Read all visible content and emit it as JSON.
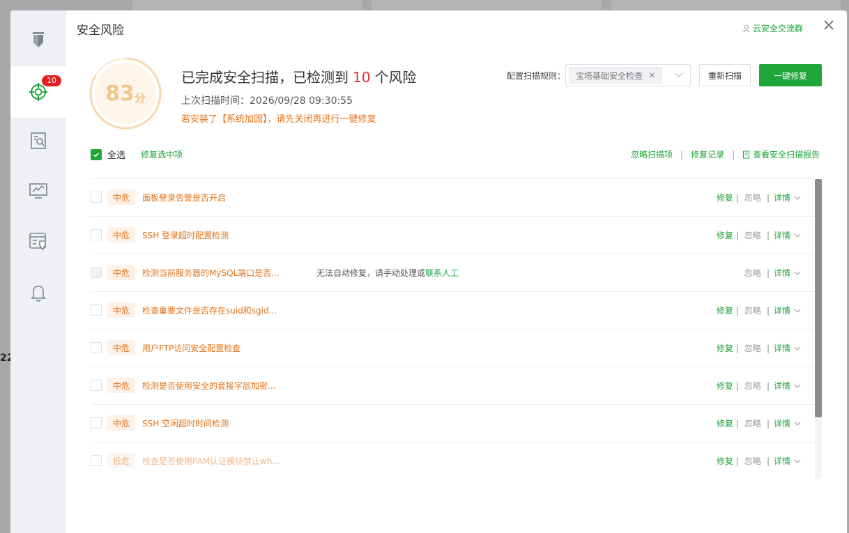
{
  "dialog": {
    "title": "安全风险",
    "group_link": "云安全交流群",
    "close_icon": "close-icon"
  },
  "sidebar": {
    "items": [
      {
        "icon": "tower-logo-icon",
        "active": false
      },
      {
        "icon": "target-scan-icon",
        "active": true,
        "badge": "10"
      },
      {
        "icon": "file-search-icon",
        "active": false
      },
      {
        "icon": "monitor-chart-icon",
        "active": false
      },
      {
        "icon": "list-shield-icon",
        "active": false
      },
      {
        "icon": "bell-icon",
        "active": false
      }
    ]
  },
  "score": {
    "value": "83",
    "unit": "分",
    "ring_fraction": 0.83
  },
  "summary": {
    "headline_prefix": "已完成安全扫描，已检测到",
    "risk_count": "10",
    "headline_suffix": "个风险",
    "last_scan": "上次扫描时间：2026/09/28 09:30:55",
    "warning": "若安装了【系统加固】，请先关闭再进行一键修复"
  },
  "scan_rule": {
    "label": "配置扫描规则：",
    "selected": "宝塔基础安全检查"
  },
  "buttons": {
    "rescan": "重新扫描",
    "fix_all": "一键修复"
  },
  "toolbar": {
    "select_all": "全选",
    "fix_selected": "修复选中项",
    "ignored_items": "忽略扫描项",
    "fix_history": "修复记录",
    "view_report": "查看安全扫描报告"
  },
  "ops": {
    "fix": "修复",
    "ignore": "忽略",
    "detail": "详情",
    "sep": "|"
  },
  "risks": [
    {
      "level": "中危",
      "name": "面板登录告警是否开启",
      "fixable": true
    },
    {
      "level": "中危",
      "name": "SSH 登录超时配置检测",
      "fixable": true
    },
    {
      "level": "中危",
      "name": "检测当前服务器的MySQL端口是否...",
      "fixable": false,
      "note": "无法自动修复，请手动处理或",
      "contact": "联系人工"
    },
    {
      "level": "中危",
      "name": "检查重要文件是否存在suid和sgid...",
      "fixable": true
    },
    {
      "level": "中危",
      "name": "用户FTP访问安全配置检查",
      "fixable": true
    },
    {
      "level": "中危",
      "name": "检测是否使用安全的套接字层加密...",
      "fixable": true
    },
    {
      "level": "中危",
      "name": "SSH 空闲超时时间检测",
      "fixable": true
    },
    {
      "level": "低危",
      "name": "检查是否使用PAM认证模块禁止wh...",
      "fixable": true
    }
  ],
  "colors": {
    "accent": "#20a53a",
    "medium_risk": "#e57217",
    "low_risk": "#f0b68a",
    "risk_count": "#e0302a",
    "score": "#f0c78a"
  },
  "background": {
    "partial_text": "22"
  }
}
